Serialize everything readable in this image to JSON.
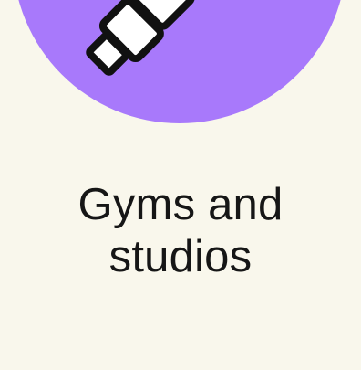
{
  "category": {
    "icon": "dumbbell-icon",
    "accent_color": "#a879fb",
    "background_color": "#f9f7ec",
    "title_line_1": "Gyms and",
    "title_line_2": "studios"
  }
}
